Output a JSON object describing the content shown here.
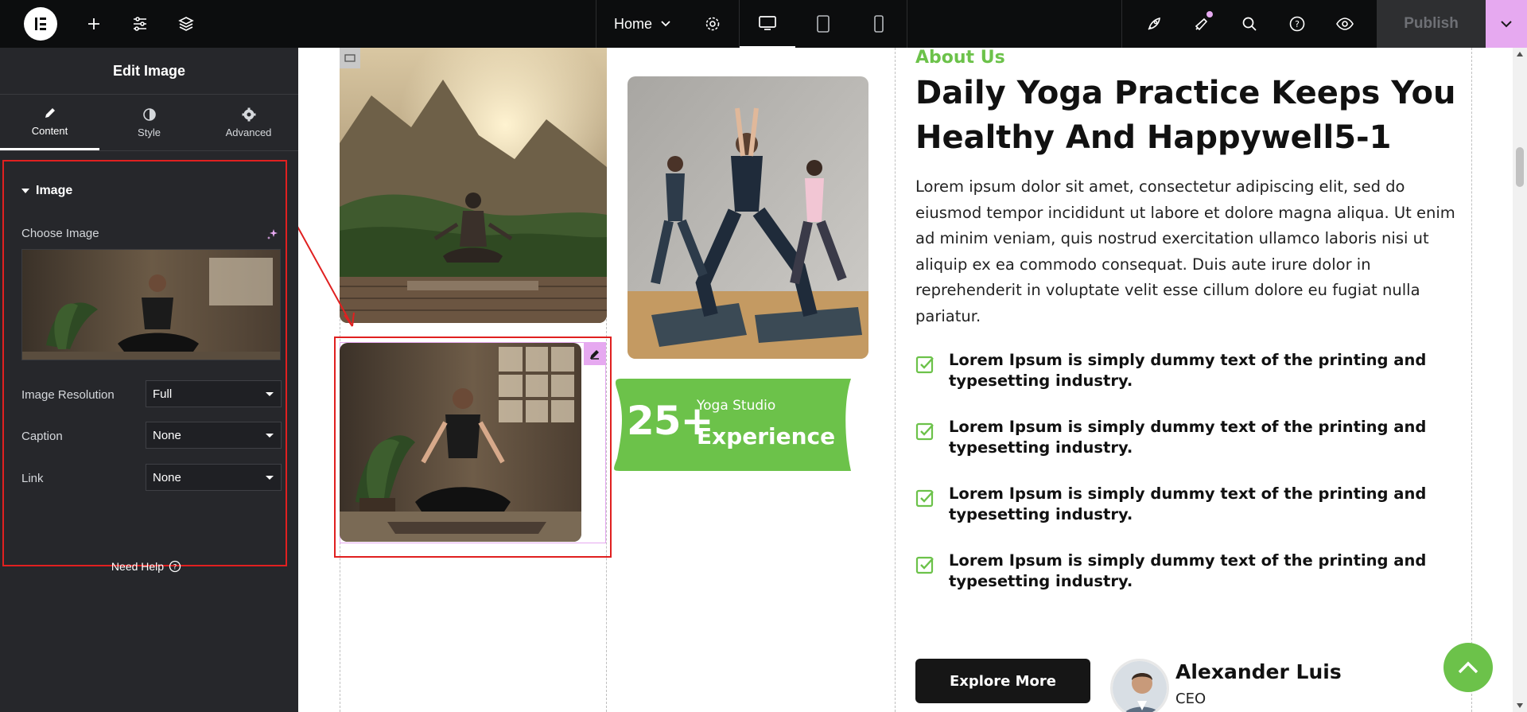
{
  "topbar": {
    "page_name": "Home",
    "publish_label": "Publish"
  },
  "panel": {
    "title": "Edit Image",
    "tabs": [
      {
        "label": "Content"
      },
      {
        "label": "Style"
      },
      {
        "label": "Advanced"
      }
    ],
    "section_title": "Image",
    "choose_image_label": "Choose Image",
    "resolution_label": "Image Resolution",
    "resolution_value": "Full",
    "caption_label": "Caption",
    "caption_value": "None",
    "link_label": "Link",
    "link_value": "None",
    "help_label": "Need Help"
  },
  "canvas": {
    "badge": {
      "number": "25+",
      "line1": "Yoga Studio",
      "line2": "Experience"
    },
    "about": {
      "subtitle": "About Us",
      "title": "Daily Yoga Practice Keeps You Healthy And Happywell5-1",
      "body": "Lorem ipsum dolor sit amet, consectetur adipiscing elit, sed do eiusmod tempor incididunt ut labore et dolore magna aliqua. Ut enim ad minim veniam, quis nostrud exercitation ullamco laboris nisi ut aliquip ex ea commodo consequat. Duis aute irure dolor in reprehenderit in voluptate velit esse cillum dolore eu fugiat nulla pariatur.",
      "checks": [
        "Lorem Ipsum is simply dummy text of the printing and typesetting industry.",
        "Lorem Ipsum is simply dummy text of the printing and typesetting industry.",
        "Lorem Ipsum is simply dummy text of the printing and typesetting industry.",
        "Lorem Ipsum is simply dummy text of the printing and typesetting industry."
      ],
      "button_label": "Explore More",
      "person_name": "Alexander Luis",
      "person_role": "CEO"
    }
  },
  "colors": {
    "accent_green": "#6cc24a",
    "selection_red": "#e02020",
    "editor_dark": "#26272b",
    "topbar_dark": "#0c0d0e",
    "publish_arrow": "#e6a9f0"
  }
}
